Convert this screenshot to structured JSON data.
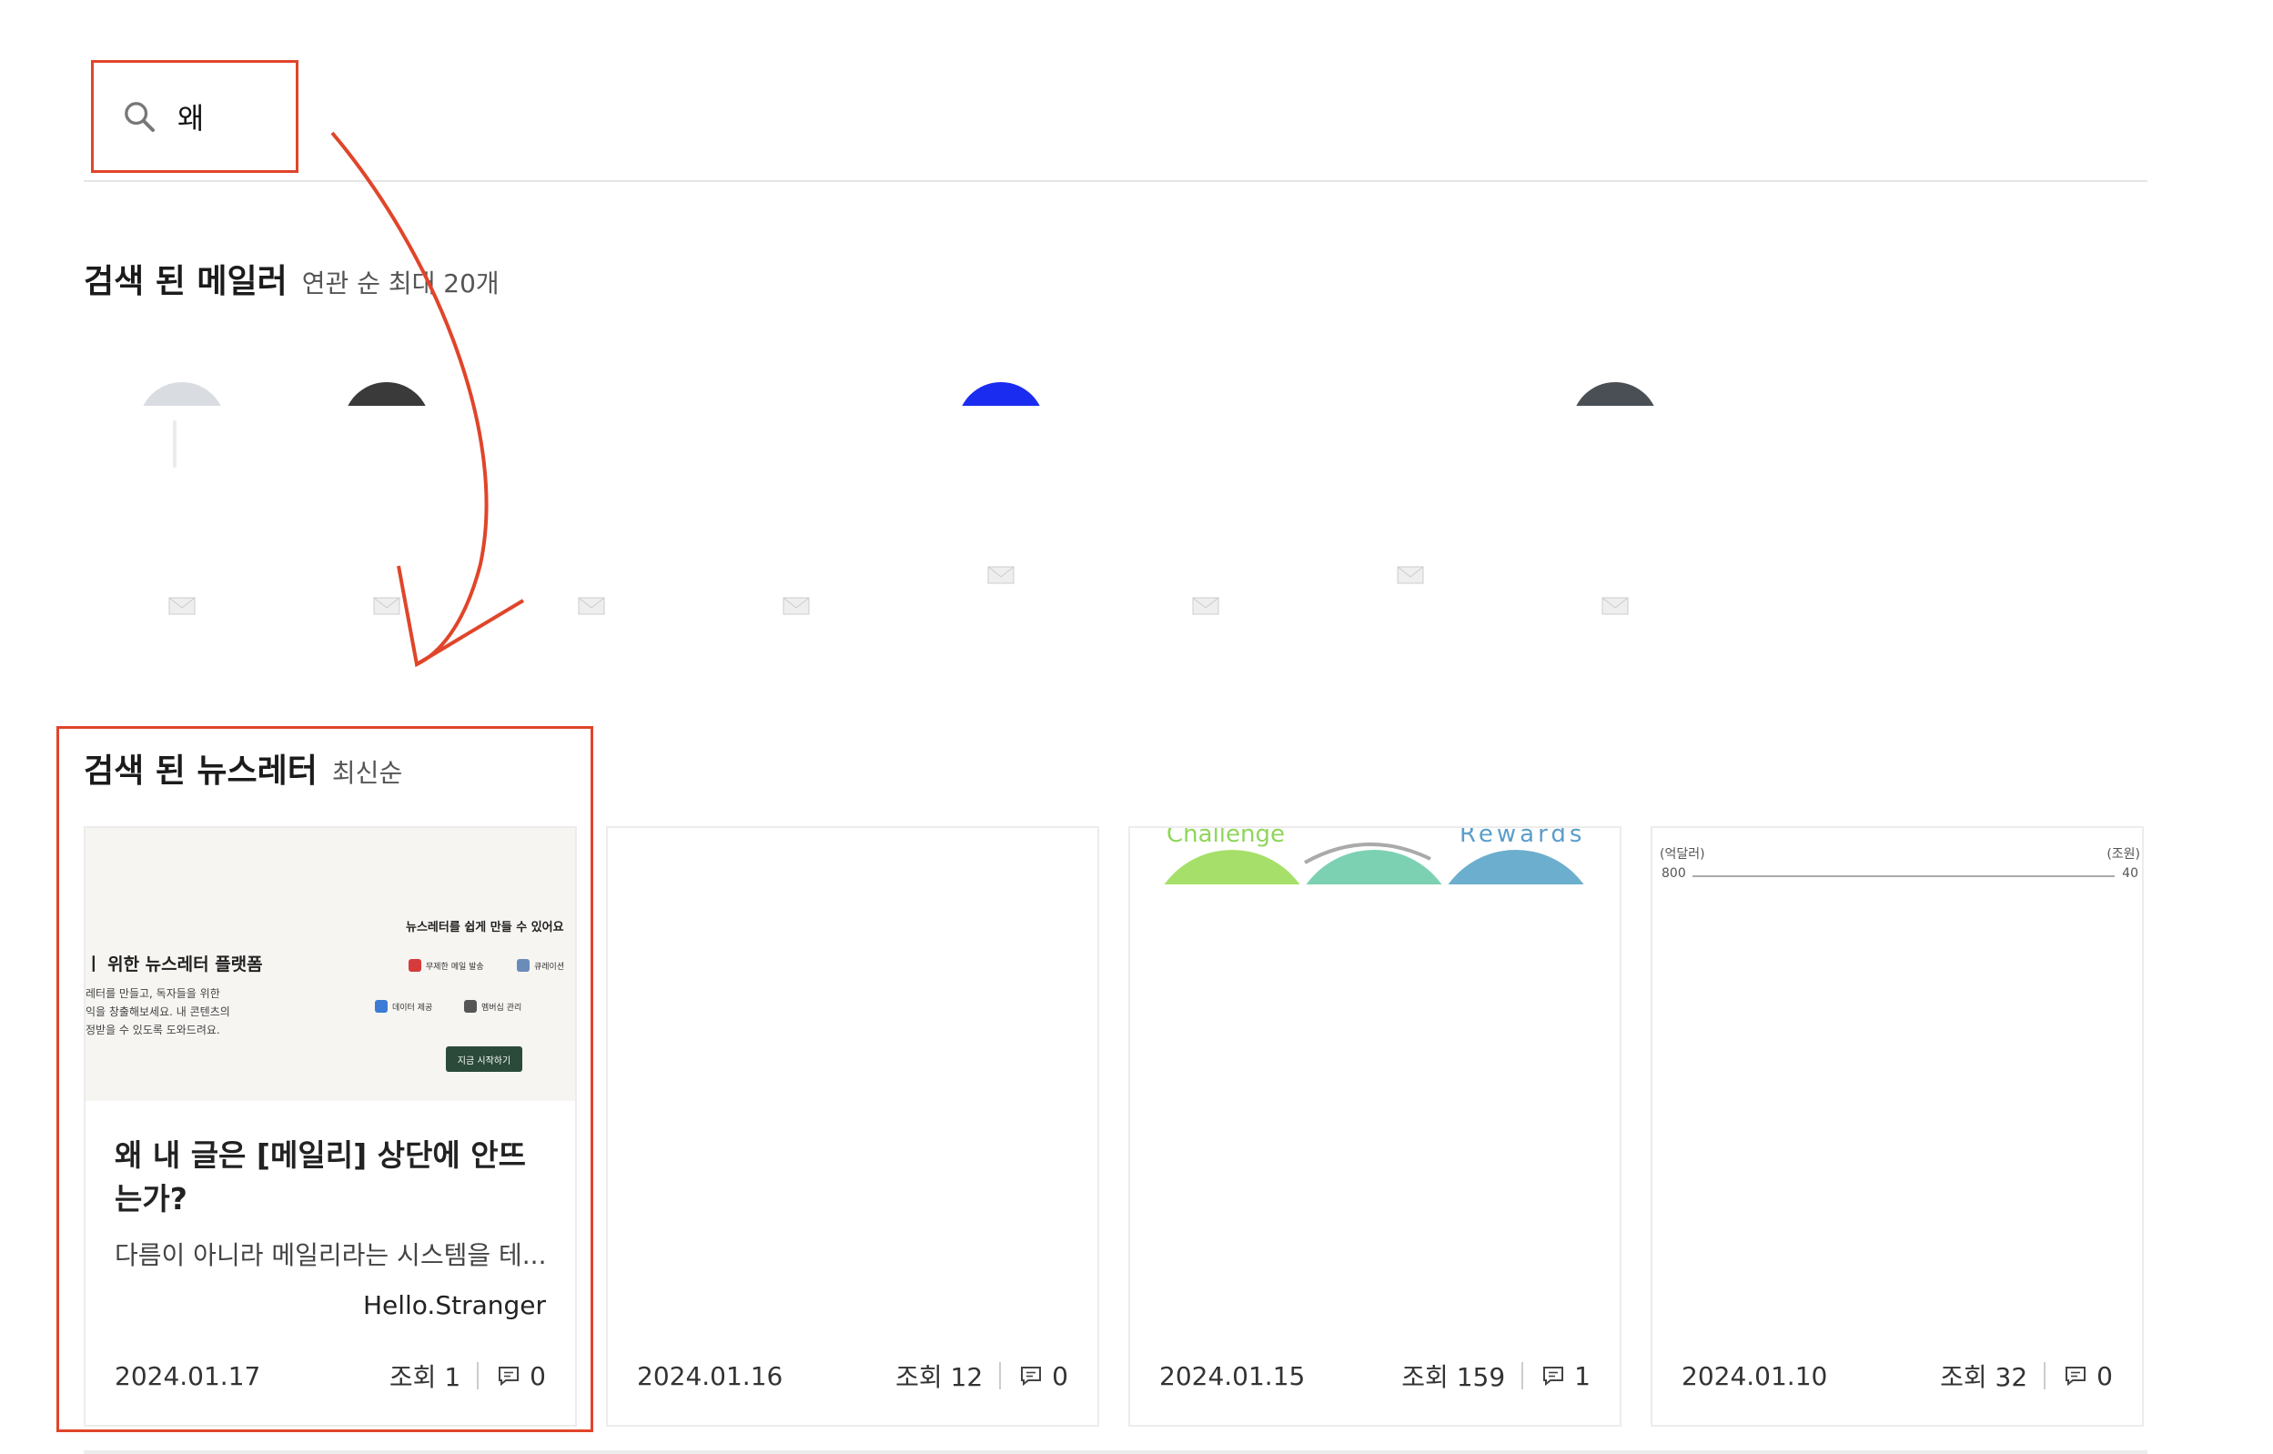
{
  "search": {
    "value": "왜"
  },
  "mailers_section": {
    "title": "검색 된 메일러",
    "subtitle": "연관 순 최대 20개"
  },
  "mailers": [
    {
      "avatar_color": "#d9dde2",
      "mail_icon": "envelope-icon"
    },
    {
      "avatar_color": "#3a3a3a",
      "mail_icon": "envelope-icon"
    },
    {
      "avatar_color": "",
      "mail_icon": "envelope-icon"
    },
    {
      "avatar_color": "",
      "mail_icon": "envelope-icon"
    },
    {
      "avatar_color": "#1a2cf0",
      "mail_icon": "envelope-icon"
    },
    {
      "avatar_color": "",
      "mail_icon": "envelope-icon"
    },
    {
      "avatar_color": "",
      "mail_icon": "envelope-icon"
    },
    {
      "avatar_color": "#4a4f55",
      "mail_icon": "envelope-icon"
    }
  ],
  "newsletters_section": {
    "title": "검색 된 뉴스레터",
    "subtitle": "최신순"
  },
  "cards": [
    {
      "thumbnail": {
        "headline": "ㅣ 위한 뉴스레터 플랫폼",
        "body": "레터를 만들고, 독자들을 위한\n익을 창출해보세요. 내 콘텐츠의\n정받을 수 있도록 도와드려요.",
        "right_title": "뉴스레터를 쉽게 만들 수 있어요",
        "features": [
          "무제한 메일 발송",
          "큐레이션",
          "데이터 제공",
          "멤버십 관리"
        ],
        "cta": "지금 시작하기"
      },
      "title": "왜 내 글은 [메일리] 상단에 안뜨는가?",
      "description": "다름이 아니라 메일리라는 시스템을 테...",
      "author": "Hello.Stranger",
      "date": "2024.01.17",
      "views": "조회 1",
      "comments": "0"
    },
    {
      "date": "2024.01.16",
      "views": "조회 12",
      "comments": "0"
    },
    {
      "chart_labels": {
        "left": "Challenge",
        "right": "Rewards"
      },
      "date": "2024.01.15",
      "views": "조회 159",
      "comments": "1"
    },
    {
      "chart_labels": {
        "left_unit": "(억달러)",
        "right_unit": "(조원)",
        "left_value": "800",
        "right_value": "40"
      },
      "date": "2024.01.10",
      "views": "조회 32",
      "comments": "0"
    }
  ],
  "colors": {
    "highlight": "#e0452a",
    "cta": "#2b4a3a"
  }
}
